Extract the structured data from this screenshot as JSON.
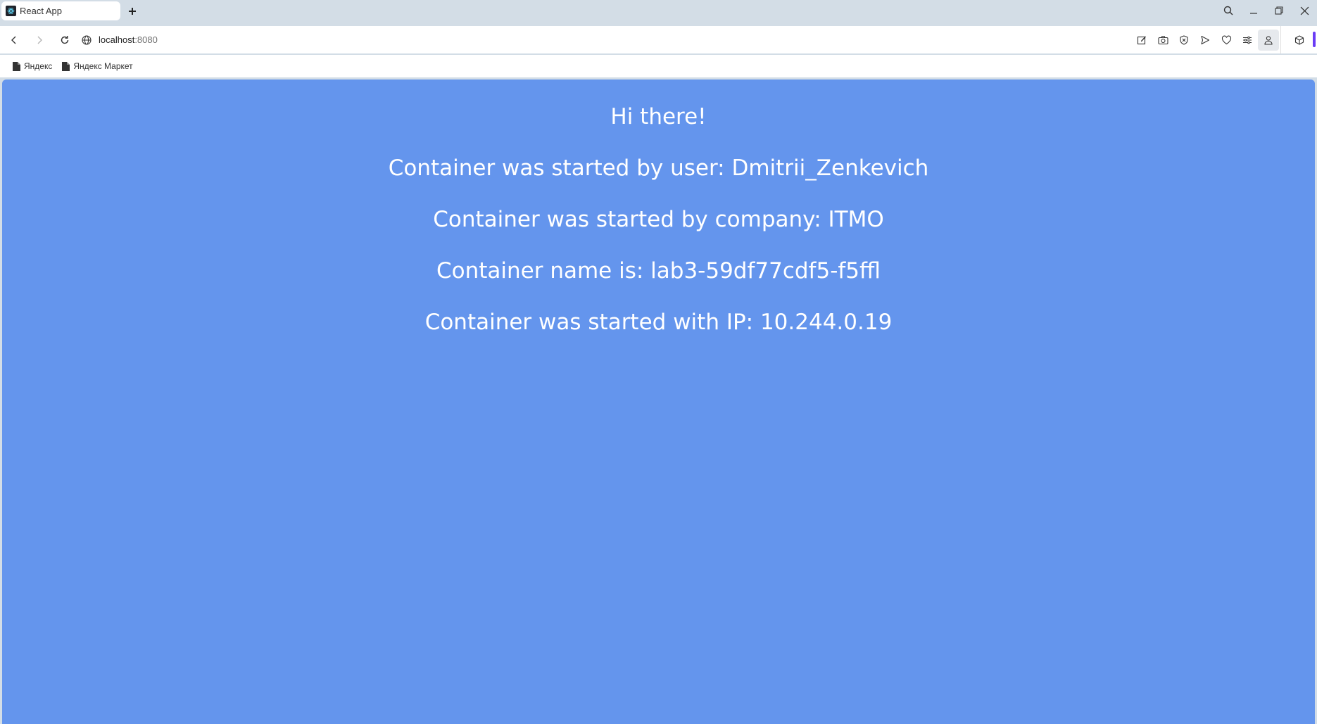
{
  "browser": {
    "tab_title": "React App",
    "address_host": "localhost",
    "address_port": ":8080",
    "bookmarks": [
      {
        "label": "Яндекс"
      },
      {
        "label": "Яндекс Маркет"
      }
    ],
    "accent_color": "#6a3cf5"
  },
  "page": {
    "background_color": "#6495ed",
    "greeting": "Hi there!",
    "user_line": "Container was started by user: Dmitrii_Zenkevich",
    "company_line": "Container was started by company: ITMO",
    "name_line": "Container name is: lab3-59df77cdf5-f5ffl",
    "ip_line": "Container was started with IP: 10.244.0.19"
  }
}
